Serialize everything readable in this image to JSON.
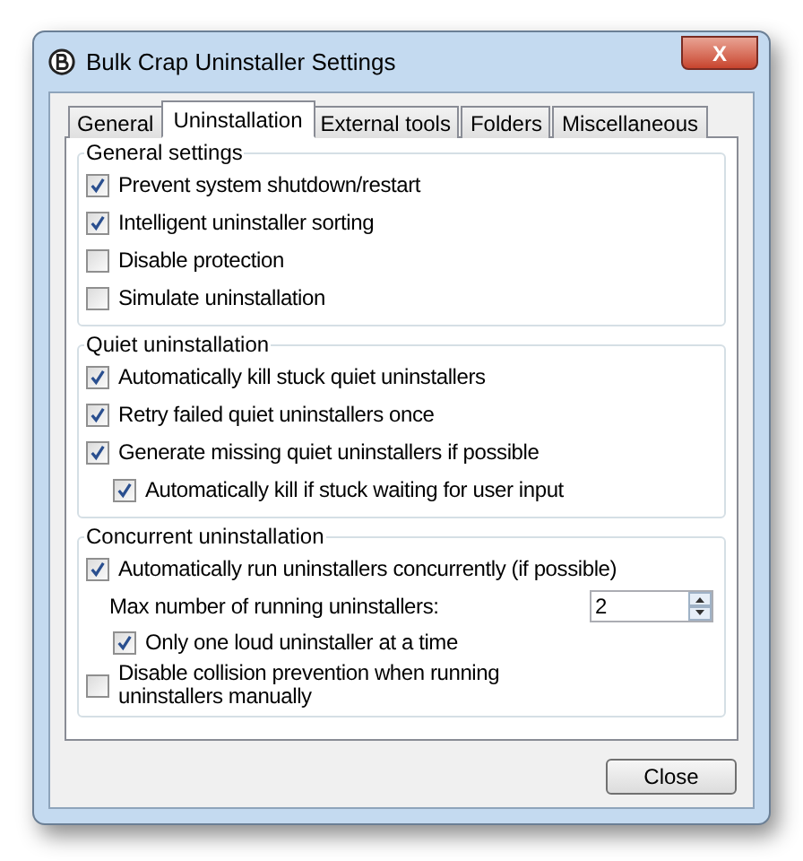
{
  "window": {
    "title": "Bulk Crap Uninstaller Settings",
    "close_glyph": "X"
  },
  "tabs": [
    {
      "label": "General",
      "selected": false
    },
    {
      "label": "Uninstallation",
      "selected": true
    },
    {
      "label": "External tools",
      "selected": false
    },
    {
      "label": "Folders",
      "selected": false
    },
    {
      "label": "Miscellaneous",
      "selected": false
    }
  ],
  "groups": [
    {
      "title": "General settings",
      "items": [
        {
          "kind": "checkbox",
          "label": "Prevent system shutdown/restart",
          "checked": true
        },
        {
          "kind": "checkbox",
          "label": "Intelligent uninstaller sorting",
          "checked": true
        },
        {
          "kind": "checkbox",
          "label": "Disable protection",
          "checked": false
        },
        {
          "kind": "checkbox",
          "label": "Simulate uninstallation",
          "checked": false
        }
      ]
    },
    {
      "title": "Quiet uninstallation",
      "items": [
        {
          "kind": "checkbox",
          "label": "Automatically kill stuck quiet uninstallers",
          "checked": true
        },
        {
          "kind": "checkbox",
          "label": "Retry failed quiet uninstallers once",
          "checked": true
        },
        {
          "kind": "checkbox",
          "label": "Generate missing quiet uninstallers if possible",
          "checked": true
        },
        {
          "kind": "subcheckbox",
          "label": "Automatically kill if stuck waiting for user input",
          "checked": true
        }
      ]
    },
    {
      "title": "Concurrent uninstallation",
      "items": [
        {
          "kind": "checkbox",
          "label": "Automatically run uninstallers concurrently (if possible)",
          "checked": true
        },
        {
          "kind": "number",
          "label": "Max number of running uninstallers:",
          "value": "2"
        },
        {
          "kind": "subcheckbox",
          "label": "Only one loud uninstaller at a time",
          "checked": true
        },
        {
          "kind": "checkbox",
          "label": "Disable collision prevention when running uninstallers manually",
          "checked": false
        }
      ]
    }
  ],
  "buttons": [
    "Close"
  ]
}
